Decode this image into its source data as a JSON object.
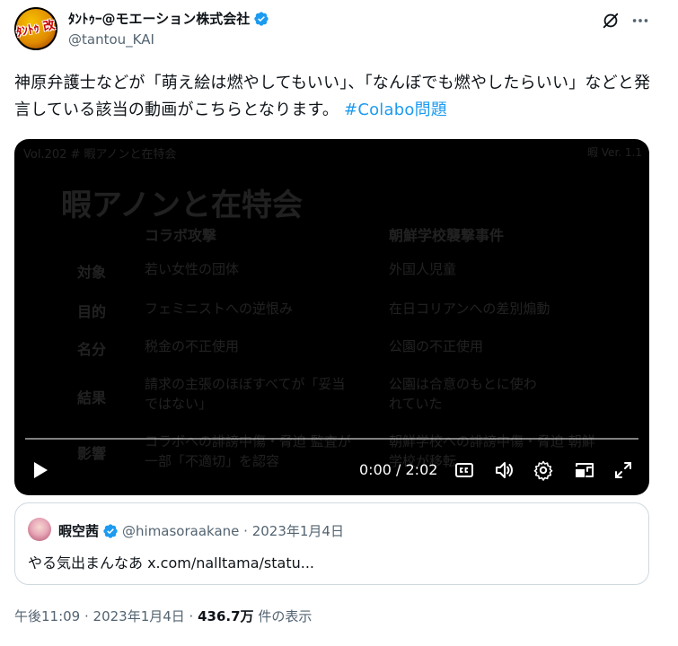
{
  "author": {
    "display_name": "ﾀﾝﾄｩｰ@モエーション株式会社",
    "handle": "@tantou_KAI",
    "avatar_text": "ﾀﾝﾄｩ 改"
  },
  "tweet": {
    "text": "神原弁護士などが「萌え絵は燃やしてもいい」、「なんぼでも燃やしたらいい」などと発言している該当の動画がこちらとなります。 ",
    "hashtag": "#Colabo問題"
  },
  "video": {
    "slide_header": "Vol.202 # 暇アノンと在特会",
    "slide_header_right": "暇 Ver. 1.1",
    "slide_title": "暇アノンと在特会",
    "columns": [
      "コラボ攻撃",
      "朝鮮学校襲撃事件"
    ],
    "rows": [
      {
        "label": "対象",
        "a": "若い女性の団体",
        "b": "外国人児童"
      },
      {
        "label": "目的",
        "a": "フェミニストへの逆恨み",
        "b": "在日コリアンへの差別煽動"
      },
      {
        "label": "名分",
        "a": "税金の不正使用",
        "b": "公園の不正使用"
      },
      {
        "label": "結果",
        "a": "請求の主張のほぼすべてが「妥当ではない」",
        "b": "公園は合意のもとに使われていた"
      },
      {
        "label": "影響",
        "a": "コラボへの誹謗中傷・脅迫 監査が一部「不適切」を認容",
        "b": "朝鮮学校への誹謗中傷・脅迫 朝鮮学校が移転"
      }
    ],
    "time": "0:00 / 2:02",
    "progress": 0.0
  },
  "quote": {
    "display_name": "暇空茜",
    "meta": "@himasoraakane · 2023年1月4日",
    "text": "やる気出まんなあ x.com/nalltama/statu..."
  },
  "footer": {
    "time": "午後11:09 · 2023年1月4日 · ",
    "views": "436.7万",
    "views_label": " 件の表示"
  },
  "colors": {
    "accent": "#1d9bf0",
    "text": "#0f1419",
    "muted": "#536471"
  },
  "icons": [
    "verified-badge-icon",
    "grok-icon",
    "more-icon",
    "play-icon",
    "captions-icon",
    "volume-icon",
    "settings-icon",
    "pip-icon",
    "fullscreen-icon"
  ]
}
